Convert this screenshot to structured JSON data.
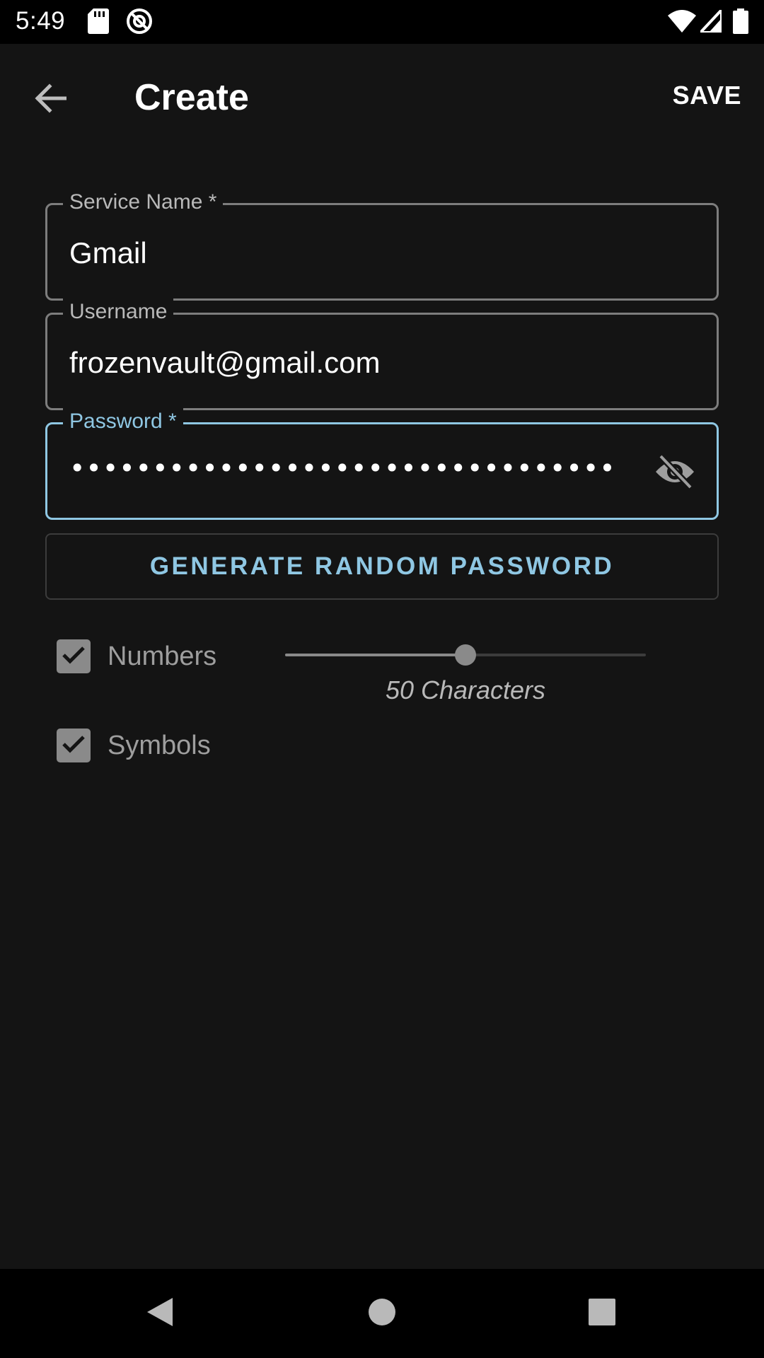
{
  "status_bar": {
    "time": "5:49",
    "icons": [
      "sd-card-icon",
      "do-not-disturb-icon",
      "wifi-icon",
      "cell-signal-icon",
      "battery-icon"
    ]
  },
  "app_bar": {
    "title": "Create",
    "save_label": "SAVE",
    "back_icon": "arrow-back-icon"
  },
  "form": {
    "service_name": {
      "label": "Service Name *",
      "value": "Gmail"
    },
    "username": {
      "label": "Username",
      "value": "frozenvault@gmail.com"
    },
    "password": {
      "label": "Password *",
      "masked_value": "••••••••••••••••••••••••••••••••••••••••••••••••••",
      "visibility_icon": "visibility-off-icon",
      "focused": true
    },
    "generate_button_label": "GENERATE RANDOM PASSWORD",
    "options": {
      "numbers": {
        "label": "Numbers",
        "checked": true
      },
      "symbols": {
        "label": "Symbols",
        "checked": true
      }
    },
    "length_slider": {
      "value_fraction": 0.5,
      "caption": "50 Characters"
    }
  },
  "nav_bar": {
    "icons": [
      "nav-back-icon",
      "nav-home-icon",
      "nav-recents-icon"
    ]
  },
  "colors": {
    "background": "#141414",
    "accent": "#8fc7e3",
    "outline": "#7d7d7d",
    "checkbox": "#8a8a8a"
  }
}
